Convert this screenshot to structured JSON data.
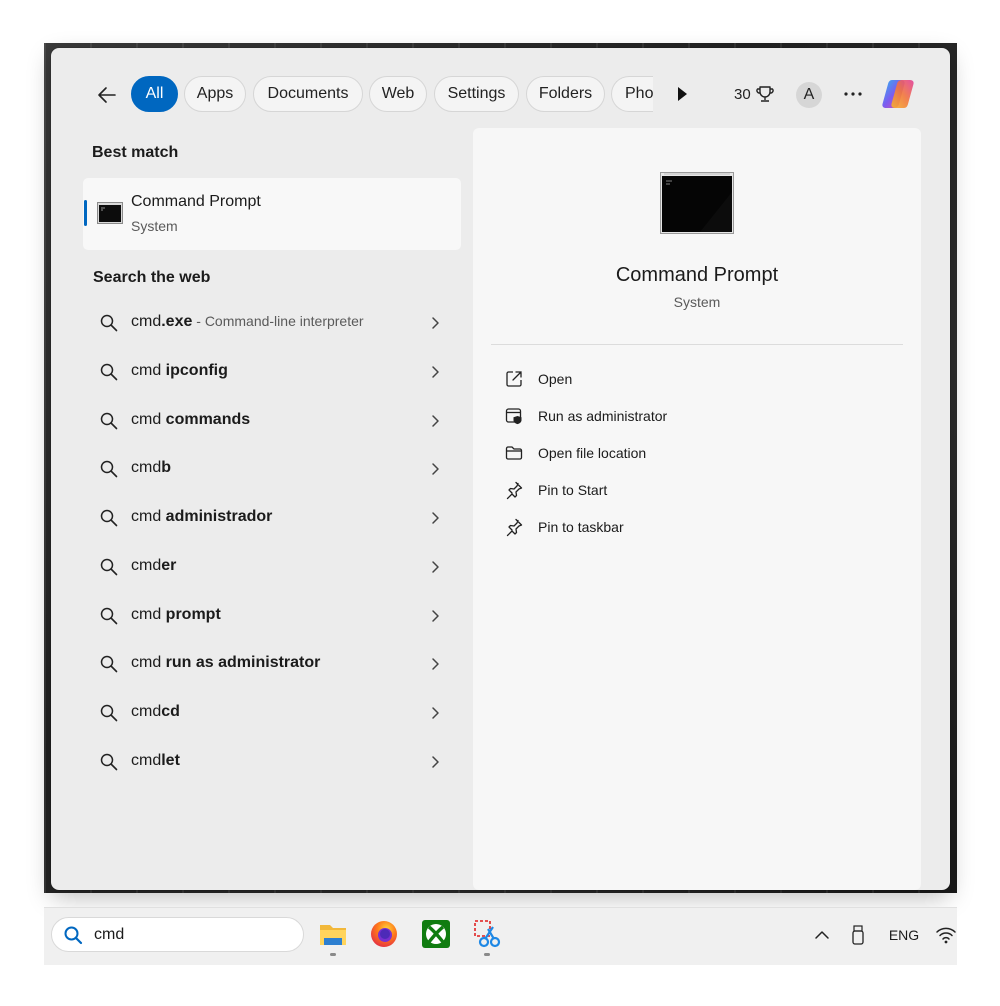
{
  "filters": {
    "items": [
      {
        "label": "All",
        "active": true
      },
      {
        "label": "Apps"
      },
      {
        "label": "Documents"
      },
      {
        "label": "Web"
      },
      {
        "label": "Settings"
      },
      {
        "label": "Folders"
      },
      {
        "label": "Pho"
      }
    ],
    "points": "30",
    "avatar_letter": "A"
  },
  "best_match": {
    "heading": "Best match",
    "name": "Command Prompt",
    "type": "System"
  },
  "web": {
    "heading": "Search the web",
    "items": [
      {
        "prefix": "cmd",
        "bold": ".exe",
        "desc": " - Command-line interpreter"
      },
      {
        "prefix": "cmd ",
        "bold": "ipconfig",
        "desc": ""
      },
      {
        "prefix": "cmd ",
        "bold": "commands",
        "desc": ""
      },
      {
        "prefix": "cmd",
        "bold": "b",
        "desc": ""
      },
      {
        "prefix": "cmd ",
        "bold": "administrador",
        "desc": ""
      },
      {
        "prefix": "cmd",
        "bold": "er",
        "desc": ""
      },
      {
        "prefix": "cmd ",
        "bold": "prompt",
        "desc": ""
      },
      {
        "prefix": "cmd ",
        "bold": "run as administrator",
        "desc": ""
      },
      {
        "prefix": "cmd",
        "bold": "cd",
        "desc": ""
      },
      {
        "prefix": "cmd",
        "bold": "let",
        "desc": ""
      }
    ]
  },
  "preview": {
    "title": "Command Prompt",
    "subtitle": "System",
    "actions": [
      {
        "label": "Open",
        "icon": "open-external-icon"
      },
      {
        "label": "Run as administrator",
        "icon": "shield-admin-icon"
      },
      {
        "label": "Open file location",
        "icon": "folder-icon"
      },
      {
        "label": "Pin to Start",
        "icon": "pin-icon"
      },
      {
        "label": "Pin to taskbar",
        "icon": "pin-icon"
      }
    ]
  },
  "taskbar": {
    "search_value": "cmd",
    "language": "ENG"
  },
  "colors": {
    "accent": "#0067c0"
  }
}
